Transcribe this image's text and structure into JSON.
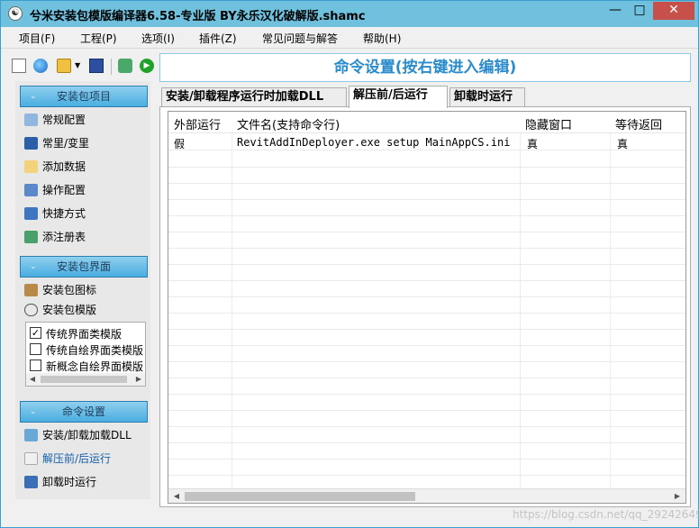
{
  "window": {
    "title": "兮米安装包模版编译器6.58-专业版 BY永乐汉化破解版.shamc",
    "app_icon_glyph": "☯",
    "controls": {
      "minimize": "—",
      "maximize": "□",
      "close": "✕"
    }
  },
  "menu": [
    "项目(F)",
    "工程(P)",
    "选项(I)",
    "插件(Z)",
    "常见问题与解答",
    "帮助(H)"
  ],
  "toolbar": {
    "icons": [
      "new-file-icon",
      "web-icon",
      "open-folder-icon",
      "dropdown-arrow-icon",
      "save-icon",
      "build-icon",
      "run-icon"
    ],
    "dropdown_glyph": "▼",
    "run_glyph": "▶"
  },
  "sidebar": {
    "section_chevron": "⌄",
    "sections": [
      {
        "title": "安装包项目",
        "items": [
          "常规配置",
          "常里/变里",
          "添加数据",
          "操作配置",
          "快捷方式",
          "添注册表"
        ]
      },
      {
        "title": "安装包界面",
        "items": [
          "安装包图标",
          "安装包模版"
        ],
        "templates": [
          {
            "label": "传统界面类模版",
            "checked": true
          },
          {
            "label": "传统自绘界面类模版",
            "checked": false
          },
          {
            "label": "新概念自绘界面模版",
            "checked": false
          }
        ]
      },
      {
        "title": "命令设置",
        "items": [
          "安装/卸载加载DLL",
          "解压前/后运行",
          "卸载时运行"
        ],
        "active_index": 1
      }
    ],
    "check_glyph": "✓",
    "scroll_left": "◀",
    "scroll_right": "▶"
  },
  "header": {
    "title": "命令设置(按右键进入编辑)"
  },
  "tabs": [
    {
      "label": "安装/卸载程序运行时加载DLL",
      "active": false
    },
    {
      "label": "解压前/后运行",
      "active": true
    },
    {
      "label": "卸载时运行",
      "active": false
    }
  ],
  "table": {
    "columns": [
      "外部运行",
      "文件名(支持命令行)",
      "隐藏窗口",
      "等待返回"
    ],
    "rows": [
      [
        "假",
        "RevitAddInDeployer.exe setup MainAppCS.ini",
        "真",
        "真"
      ]
    ]
  },
  "watermark": "https://blog.csdn.net/qq_29242649",
  "colors": {
    "accent": "#2a8ccc",
    "titlebar": "#6fc1de",
    "close": "#c7504a"
  }
}
